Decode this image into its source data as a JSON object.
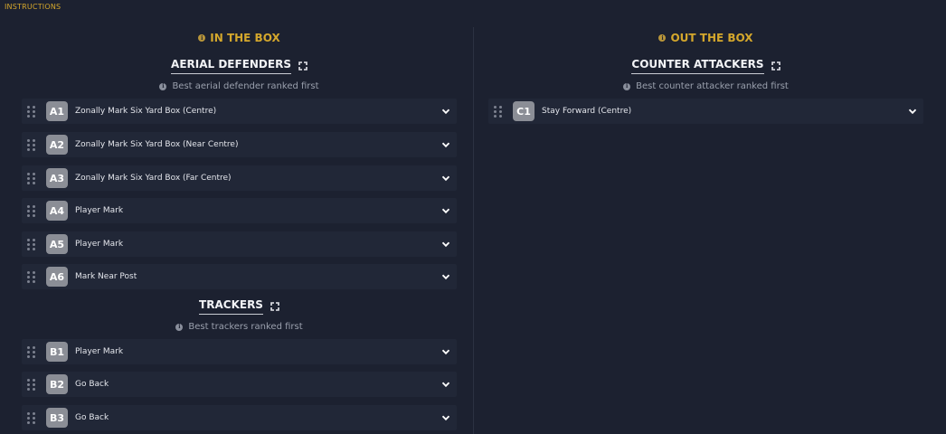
{
  "header": {
    "label": "INSTRUCTIONS"
  },
  "left": {
    "zone_title": "IN THE BOX",
    "groups": [
      {
        "title": "AERIAL DEFENDERS",
        "subtitle": "Best aerial defender ranked first",
        "rows": [
          {
            "badge": "A1",
            "label": "Zonally Mark Six Yard Box (Centre)"
          },
          {
            "badge": "A2",
            "label": "Zonally Mark Six Yard Box (Near Centre)"
          },
          {
            "badge": "A3",
            "label": "Zonally Mark Six Yard Box (Far Centre)"
          },
          {
            "badge": "A4",
            "label": "Player Mark"
          },
          {
            "badge": "A5",
            "label": "Player Mark"
          },
          {
            "badge": "A6",
            "label": "Mark Near Post"
          }
        ]
      },
      {
        "title": "TRACKERS",
        "subtitle": "Best trackers ranked first",
        "rows": [
          {
            "badge": "B1",
            "label": "Player Mark"
          },
          {
            "badge": "B2",
            "label": "Go Back"
          },
          {
            "badge": "B3",
            "label": "Go Back"
          }
        ]
      }
    ]
  },
  "right": {
    "zone_title": "OUT THE BOX",
    "groups": [
      {
        "title": "COUNTER ATTACKERS",
        "subtitle": "Best counter attacker ranked first",
        "rows": [
          {
            "badge": "C1",
            "label": "Stay Forward (Centre)"
          }
        ]
      }
    ]
  },
  "icons": {
    "info": "info-icon",
    "expand": "expand-icon",
    "drag": "drag-handle-icon",
    "chevron": "chevron-down-icon"
  },
  "colors": {
    "background": "#1c2130",
    "row": "#212737",
    "accent": "#d4a72c",
    "badge": "#8b8e96"
  }
}
